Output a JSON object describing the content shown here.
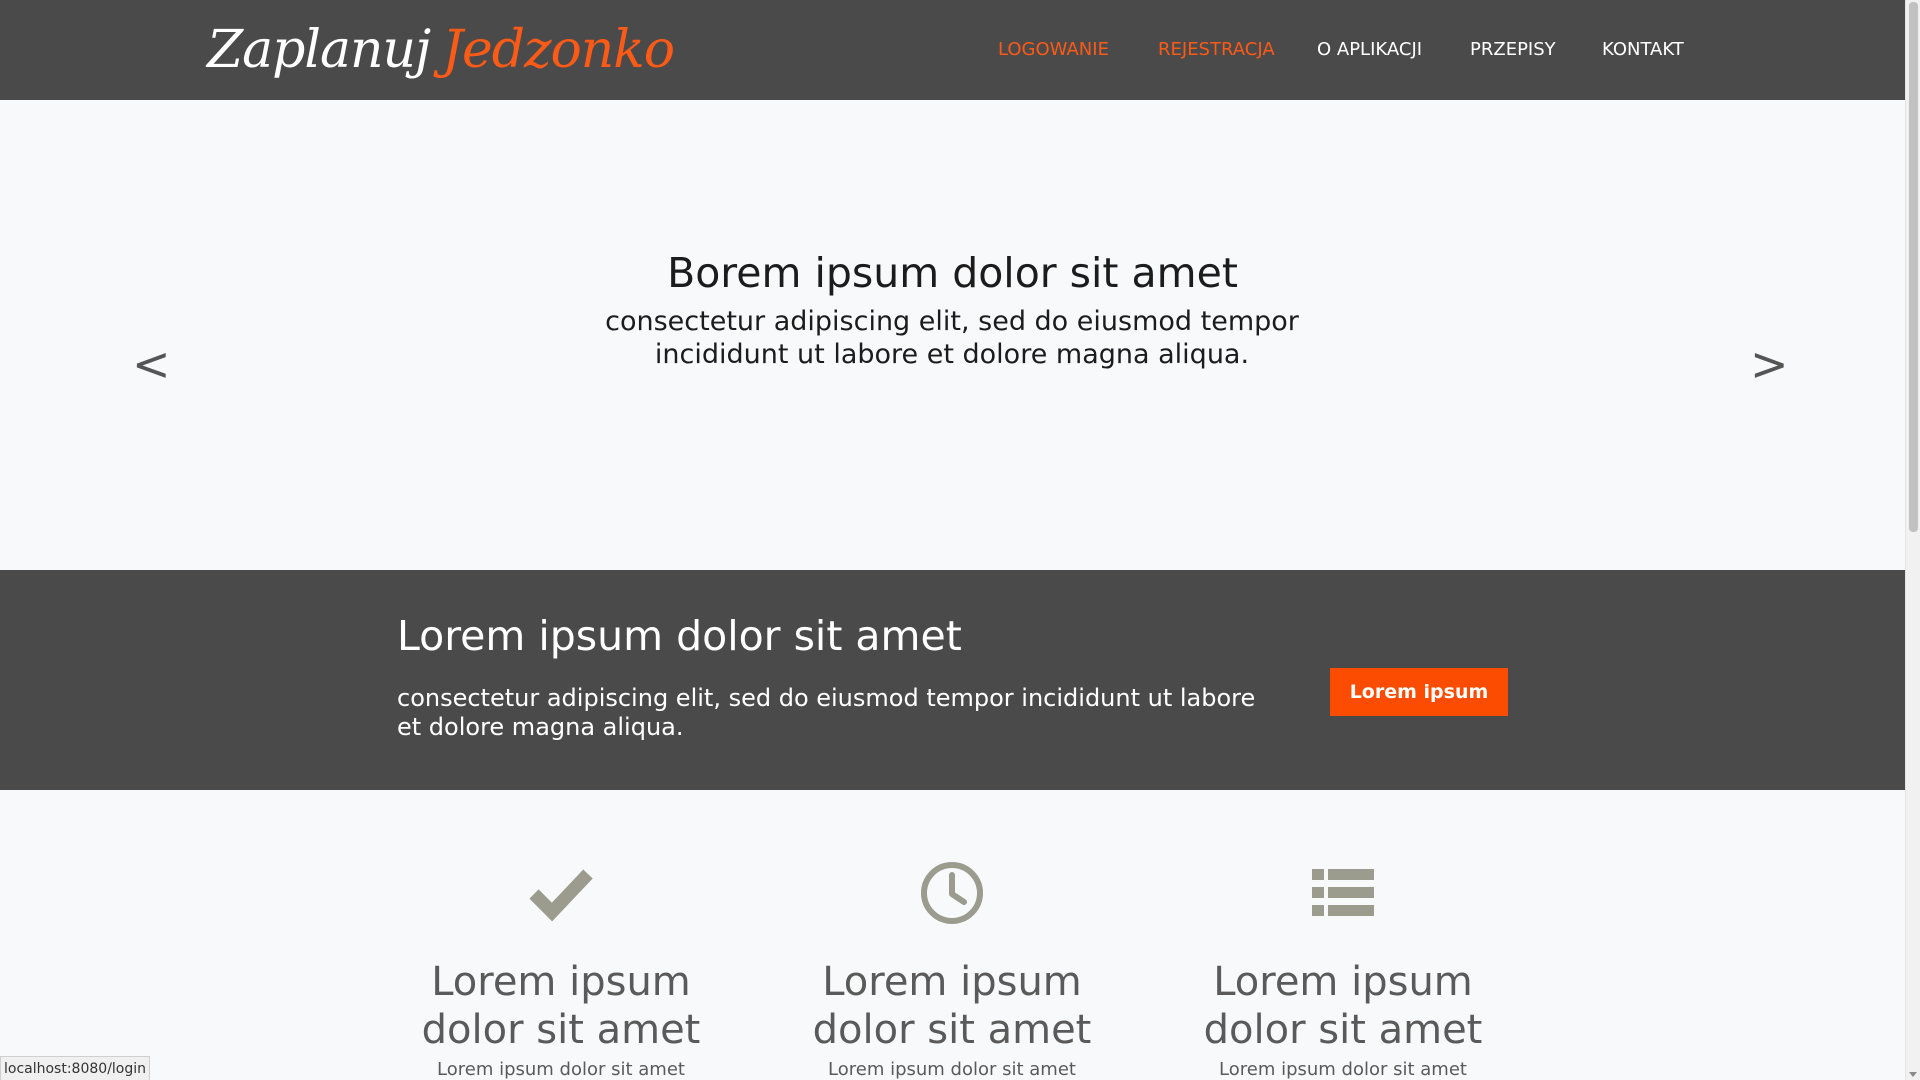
{
  "colors": {
    "header_bg": "#4a4a4a",
    "accent": "#fc4c02",
    "page_bg": "#f8f9fa",
    "icon": "#9b9b8e"
  },
  "header": {
    "logo_part1": "Zaplanuj",
    "logo_part2": "Jedzonko",
    "nav": [
      {
        "label": "LOGOWANIE"
      },
      {
        "label": "REJESTRACJA"
      },
      {
        "label": "O APLIKACJI"
      },
      {
        "label": "PRZEPISY"
      },
      {
        "label": "KONTAKT"
      }
    ]
  },
  "hero": {
    "title": "Borem ipsum dolor sit amet",
    "subtitle": "consectetur adipiscing elit, sed do eiusmod tempor incididunt ut labore et dolore magna aliqua.",
    "prev_label": "<",
    "next_label": ">"
  },
  "band": {
    "title": "Lorem ipsum dolor sit amet",
    "text": "consectetur adipiscing elit, sed do eiusmod tempor incididunt ut labore et dolore magna aliqua.",
    "button_label": "Lorem ipsum"
  },
  "features": [
    {
      "icon": "check-icon",
      "title": "Lorem ipsum dolor sit amet",
      "text": "Lorem ipsum dolor sit amet"
    },
    {
      "icon": "clock-icon",
      "title": "Lorem ipsum dolor sit amet",
      "text": "Lorem ipsum dolor sit amet"
    },
    {
      "icon": "list-icon",
      "title": "Lorem ipsum dolor sit amet",
      "text": "Lorem ipsum dolor sit amet"
    }
  ],
  "status_url": "localhost:8080/login"
}
